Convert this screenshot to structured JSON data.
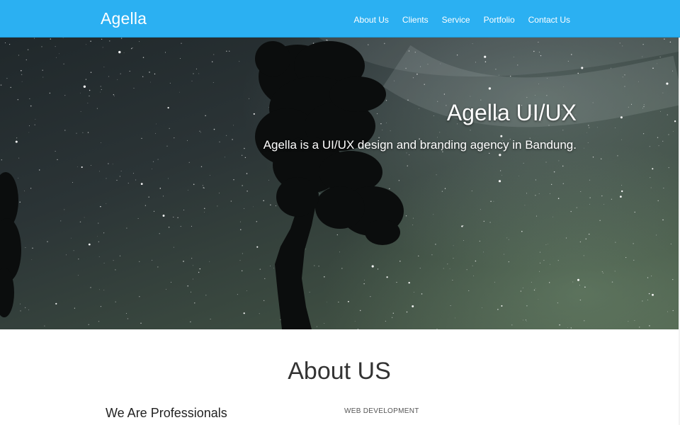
{
  "navbar": {
    "brand": "Agella",
    "links": [
      "About Us",
      "Clients",
      "Service",
      "Portfolio",
      "Contact Us"
    ]
  },
  "hero": {
    "title": "Agella UI/UX",
    "subtitle": "Agella is a UI/UX design and branding agency in Bandung."
  },
  "about": {
    "heading": "About US",
    "subheading": "We Are Professionals",
    "skill_label": "WEB DEVELOPMENT"
  },
  "colors": {
    "navbar": "#2bb0f2",
    "text_light": "#ffffff",
    "text_dark": "#333333"
  }
}
